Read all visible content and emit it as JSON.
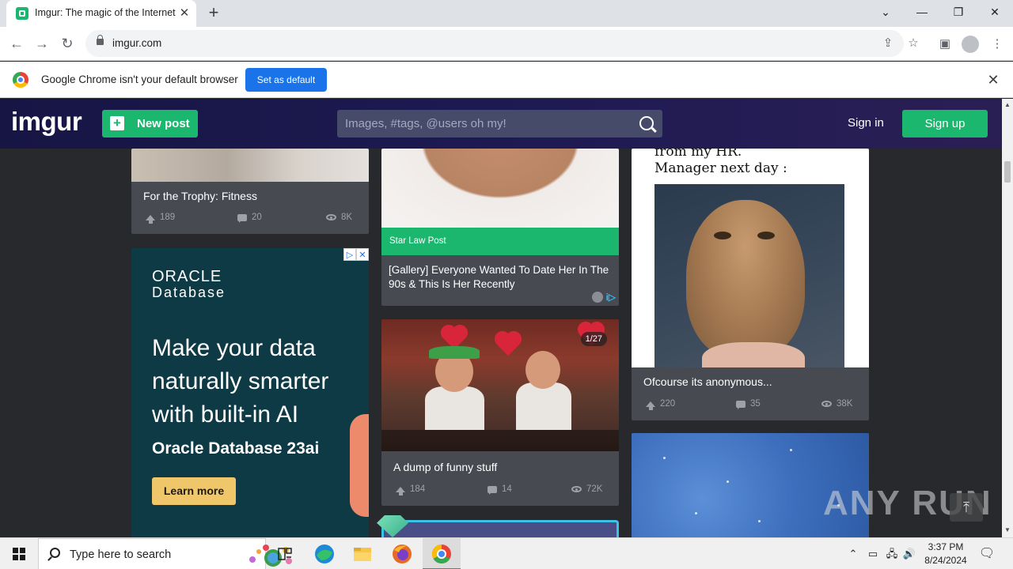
{
  "browser": {
    "tab_title": "Imgur: The magic of the Internet",
    "tab_close": "✕",
    "new_tab": "+",
    "url": "imgur.com",
    "win_controls": [
      "⌄",
      "—",
      "❐",
      "✕"
    ]
  },
  "infobar": {
    "message": "Google Chrome isn't your default browser",
    "set_default_label": "Set as default",
    "close": "✕"
  },
  "imgur_header": {
    "logo": "imgur",
    "new_post_label": "New post",
    "search_placeholder": "Images, #tags, @users oh my!",
    "sign_in_label": "Sign in",
    "sign_up_label": "Sign up"
  },
  "posts": {
    "fitness": {
      "title": "For the Trophy: Fitness",
      "upvotes": "189",
      "comments": "20",
      "views": "8K"
    },
    "sponsored": {
      "sponsor": "Star Law Post",
      "title": "[Gallery] Everyone Wanted To Date Her In The 90s & This Is Her Recently"
    },
    "dump": {
      "title": "A dump of funny stuff",
      "upvotes": "184",
      "comments": "14",
      "views": "72K",
      "image_count": "1/27"
    },
    "owl": {
      "meme_line1": "from my HR.",
      "meme_line2": "Manager next day :",
      "title": "Ofcourse its anonymous...",
      "upvotes": "220",
      "comments": "35",
      "views": "38K"
    }
  },
  "oracle_ad": {
    "logo": "ORACLE",
    "logo_sub": "Database",
    "headline": "Make your data naturally smarter with built-in AI",
    "product": "Oracle Database 23ai",
    "cta": "Learn more"
  },
  "watermark": "ANY RUN",
  "taskbar": {
    "search_placeholder": "Type here to search",
    "time": "3:37 PM",
    "date": "8/24/2024"
  },
  "colors": {
    "imgur_green": "#1bb76e",
    "imgur_header": "#171544",
    "page_bg": "#27292d",
    "card_bg": "#474a51",
    "chrome_blue": "#1a73e8"
  }
}
